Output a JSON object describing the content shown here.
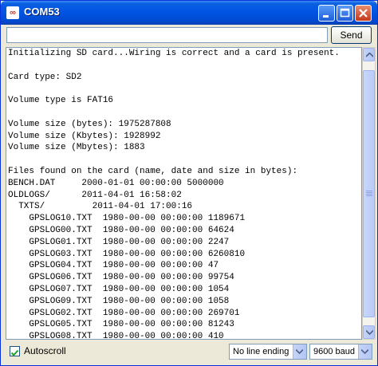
{
  "window": {
    "title": "COM53"
  },
  "input": {
    "value": "",
    "placeholder": ""
  },
  "send_label": "Send",
  "output_lines": [
    "Initializing SD card...Wiring is correct and a card is present.",
    "",
    "Card type: SD2",
    "",
    "Volume type is FAT16",
    "",
    "Volume size (bytes): 1975287808",
    "Volume size (Kbytes): 1928992",
    "Volume size (Mbytes): 1883",
    "",
    "Files found on the card (name, date and size in bytes):",
    "BENCH.DAT     2000-01-01 00:00:00 5000000",
    "OLDLOGS/      2011-04-01 16:58:02",
    "  TXTS/         2011-04-01 17:00:16",
    "    GPSLOG10.TXT  1980-00-00 00:00:00 1189671",
    "    GPSLOG00.TXT  1980-00-00 00:00:00 64624",
    "    GPSLOG01.TXT  1980-00-00 00:00:00 2247",
    "    GPSLOG03.TXT  1980-00-00 00:00:00 6260810",
    "    GPSLOG04.TXT  1980-00-00 00:00:00 47",
    "    GPSLOG06.TXT  1980-00-00 00:00:00 99754",
    "    GPSLOG07.TXT  1980-00-00 00:00:00 1054",
    "    GPSLOG09.TXT  1980-00-00 00:00:00 1058",
    "    GPSLOG02.TXT  1980-00-00 00:00:00 269701",
    "    GPSLOG05.TXT  1980-00-00 00:00:00 81243",
    "    GPSLOG08.TXT  1980-00-00 00:00:00 410"
  ],
  "autoscroll": {
    "label": "Autoscroll",
    "checked": true
  },
  "line_ending": {
    "selected": "No line ending"
  },
  "baud": {
    "selected": "9600 baud"
  },
  "colors": {
    "titlebar": "#0054e3",
    "close_button": "#c4391b",
    "border": "#7f9db9"
  },
  "icons": [
    "app-icon",
    "minimize-icon",
    "maximize-icon",
    "close-icon",
    "scroll-up-icon",
    "scroll-down-icon",
    "checkmark-icon",
    "dropdown-arrow-icon"
  ]
}
